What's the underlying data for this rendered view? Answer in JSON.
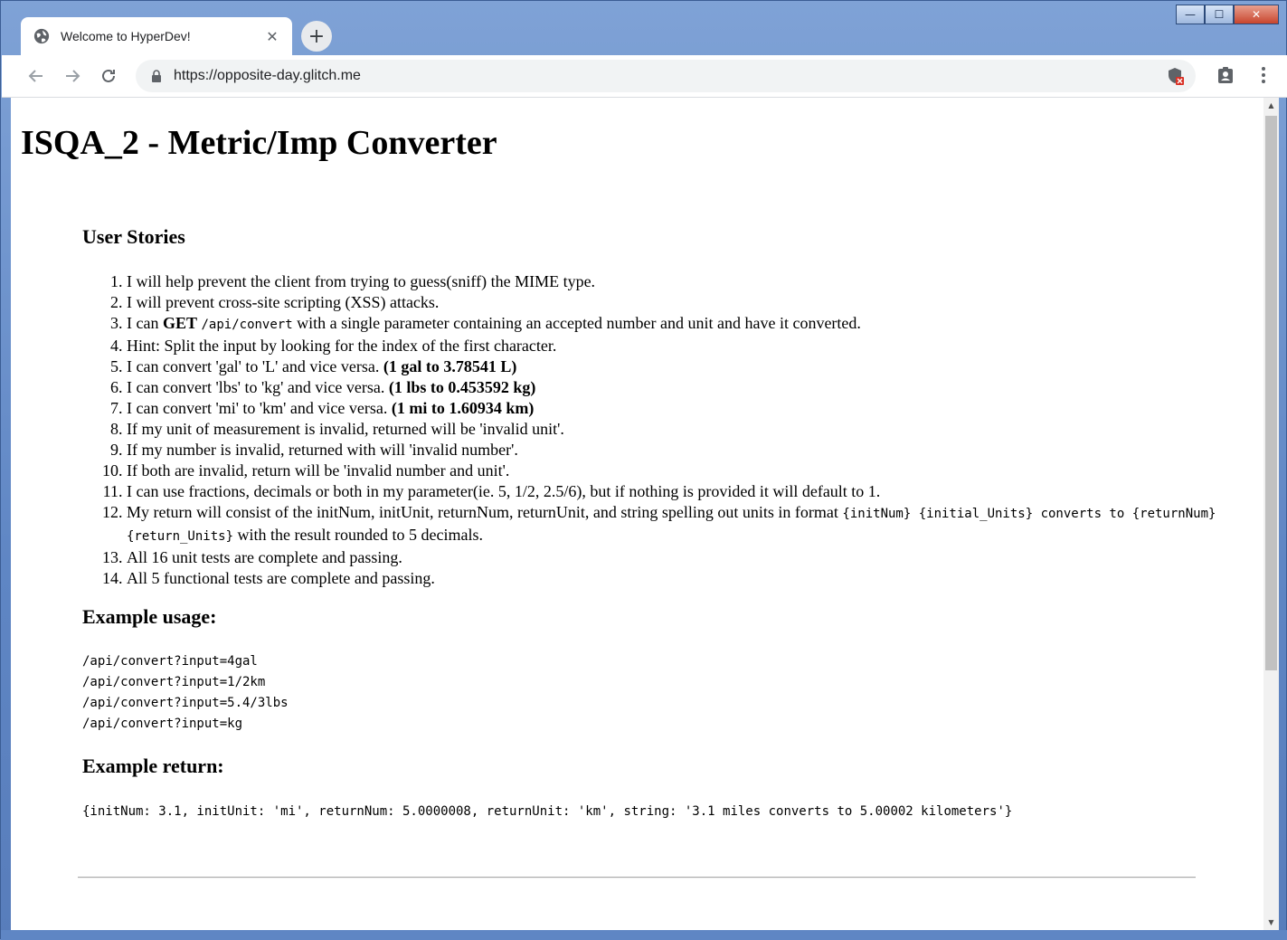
{
  "browser": {
    "tab_title": "Welcome to HyperDev!",
    "tab_close": "✕",
    "new_tab": "+",
    "url": "https://opposite-day.glitch.me",
    "window_controls": {
      "minimize": "—",
      "maximize": "☐",
      "close": "✕"
    }
  },
  "page": {
    "title": "ISQA_2 - Metric/Imp Converter",
    "user_stories_heading": "User Stories",
    "stories": [
      {
        "text": "I will help prevent the client from trying to guess(sniff) the MIME type."
      },
      {
        "text": "I will prevent cross-site scripting (XSS) attacks."
      },
      {
        "pre": "I can ",
        "bold": "GET",
        "code": "/api/convert",
        "post": " with a single parameter containing an accepted number and unit and have it converted."
      },
      {
        "text": "Hint: Split the input by looking for the index of the first character."
      },
      {
        "pre": "I can convert 'gal' to 'L' and vice versa. ",
        "bold": "(1 gal to 3.78541 L)"
      },
      {
        "pre": "I can convert 'lbs' to 'kg' and vice versa. ",
        "bold": "(1 lbs to 0.453592 kg)"
      },
      {
        "pre": "I can convert 'mi' to 'km' and vice versa. ",
        "bold": "(1 mi to 1.60934 km)"
      },
      {
        "text": "If my unit of measurement is invalid, returned will be 'invalid unit'."
      },
      {
        "text": "If my number is invalid, returned with will 'invalid number'."
      },
      {
        "text": "If both are invalid, return will be 'invalid number and unit'."
      },
      {
        "text": "I can use fractions, decimals or both in my parameter(ie. 5, 1/2, 2.5/6), but if nothing is provided it will default to 1."
      },
      {
        "pre": "My return will consist of the initNum, initUnit, returnNum, returnUnit, and string spelling out units in format ",
        "code": "{initNum} {initial_Units} converts to {returnNum} {return_Units}",
        "post": " with the result rounded to 5 decimals."
      },
      {
        "text": "All 16 unit tests are complete and passing."
      },
      {
        "text": "All 5 functional tests are complete and passing."
      }
    ],
    "example_usage_heading": "Example usage:",
    "example_usage": [
      "/api/convert?input=4gal",
      "/api/convert?input=1/2km",
      "/api/convert?input=5.4/3lbs",
      "/api/convert?input=kg"
    ],
    "example_return_heading": "Example return:",
    "example_return": "{initNum: 3.1, initUnit: 'mi', returnNum: 5.0000008, returnUnit: 'km', string: '3.1 miles converts to 5.00002 kilometers'}"
  },
  "icons": {
    "back": "back-arrow-icon",
    "forward": "forward-arrow-icon",
    "reload": "reload-icon",
    "lock": "lock-icon",
    "shield": "shield-blocked-icon",
    "profile": "profile-badge-icon",
    "menu": "kebab-menu-icon",
    "globe": "globe-icon"
  },
  "colors": {
    "titlebar": "#5f86c4",
    "omnibox": "#f1f3f4",
    "text": "#202124"
  }
}
